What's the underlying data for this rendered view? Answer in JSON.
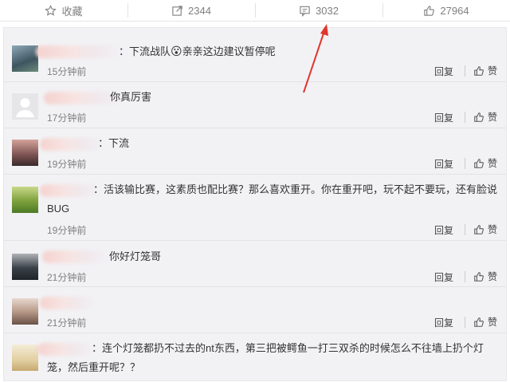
{
  "actionbar": {
    "favorite": {
      "label": "收藏",
      "icon": "star-icon"
    },
    "share": {
      "count": "2344",
      "icon": "share-icon"
    },
    "comment": {
      "count": "3032",
      "icon": "comment-icon"
    },
    "like": {
      "count": "27964",
      "icon": "thumbs-up-icon"
    }
  },
  "accent": "#e0362c",
  "comments": [
    {
      "text": "：下流战队",
      "emoji": "😮",
      "text2": "亲亲这边建议暂停呢",
      "time": "15分钟前"
    },
    {
      "text": "你真厉害",
      "time": "17分钟前"
    },
    {
      "text": "：下流",
      "time": "19分钟前"
    },
    {
      "text": "：活该输比赛，这素质也配比赛？那么喜欢重开。你在重开吧，玩不起不要玩，还有脸说",
      "text_line2": "BUG",
      "time": "19分钟前"
    },
    {
      "text": "你好灯笼哥",
      "time": "21分钟前"
    },
    {
      "text": "",
      "time": "21分钟前"
    },
    {
      "text": "：连个灯笼都扔不过去的nt东西，第三把被鳄鱼一打三双杀的时候怎么不往墙上扔个灯",
      "text_line2": "笼，然后重开呢？？"
    }
  ],
  "actions": {
    "reply": "回复",
    "like": "赞"
  }
}
